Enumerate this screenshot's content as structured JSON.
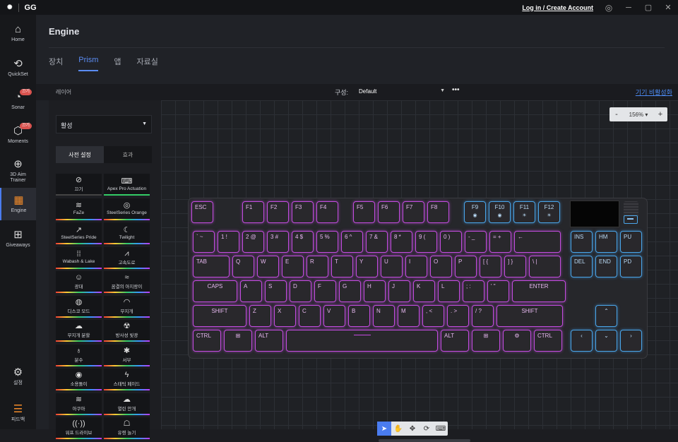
{
  "titlebar": {
    "brand": "GG",
    "login": "Log in / Create Account",
    "minimize": "─",
    "maximize": "▢",
    "close": "✕"
  },
  "sidebar": {
    "items": [
      {
        "label": "Home",
        "icon": "home-icon",
        "glyph": "⌂"
      },
      {
        "label": "QuickSet",
        "icon": "quickset-icon",
        "glyph": "⟲"
      },
      {
        "label": "Sonar",
        "icon": "sonar-icon",
        "glyph": "◔",
        "badge": "끄기"
      },
      {
        "label": "Moments",
        "icon": "moments-icon",
        "glyph": "⬡",
        "badge": "끄기"
      },
      {
        "label": "3D Aim Trainer",
        "icon": "aim-trainer-icon",
        "glyph": "⊕"
      },
      {
        "label": "Engine",
        "icon": "engine-icon",
        "glyph": "▦",
        "active": true
      },
      {
        "label": "Giveaways",
        "icon": "giveaways-icon",
        "glyph": "⊞"
      }
    ],
    "settings": {
      "label": "설정",
      "glyph": "⚙"
    },
    "feedback": {
      "label": "피드백",
      "glyph": "☰"
    }
  },
  "header": {
    "title": "Engine"
  },
  "tabs": [
    {
      "label": "장치"
    },
    {
      "label": "Prism",
      "active": true
    },
    {
      "label": "앱"
    },
    {
      "label": "자료실"
    }
  ],
  "toolbar": {
    "layer_label": "레이어",
    "config_label": "구성:",
    "config_value": "Default",
    "more": "•••",
    "disable_link": "기기 비활성화"
  },
  "layer_panel": {
    "dropdown_value": "활성",
    "segments": [
      "사전 설정",
      "효과"
    ],
    "presets": [
      {
        "label": "끄기",
        "glyph": "⊘"
      },
      {
        "label": "Apex Pro Actuation",
        "glyph": "⌨"
      },
      {
        "label": "FaZe",
        "glyph": "≋"
      },
      {
        "label": "SteelSeries Orange",
        "glyph": "◎"
      },
      {
        "label": "SteelSeries Pride",
        "glyph": "↗"
      },
      {
        "label": "Twilight",
        "glyph": "☾"
      },
      {
        "label": "Wabash & Lake",
        "glyph": "⁞⁞"
      },
      {
        "label": "고속도로",
        "glyph": "⩘"
      },
      {
        "label": "광대",
        "glyph": "☺"
      },
      {
        "label": "꿈결의 아지랑이",
        "glyph": "≈"
      },
      {
        "label": "디스코 모드",
        "glyph": "◍"
      },
      {
        "label": "무지개",
        "glyph": "◠"
      },
      {
        "label": "무지개 분할",
        "glyph": "☁"
      },
      {
        "label": "방사성 빛광",
        "glyph": "☢"
      },
      {
        "label": "분수",
        "glyph": "♁"
      },
      {
        "label": "서부",
        "glyph": "✱"
      },
      {
        "label": "소용돌이",
        "glyph": "◉"
      },
      {
        "label": "스태틱 페이드",
        "glyph": "ϟ"
      },
      {
        "label": "아쿠아",
        "glyph": "≋"
      },
      {
        "label": "열린 안개",
        "glyph": "☁"
      },
      {
        "label": "워프 드라이브",
        "glyph": "((·))"
      },
      {
        "label": "유령 놀기",
        "glyph": "☖"
      }
    ]
  },
  "canvas": {
    "zoom": "156%",
    "zoom_minus": "-",
    "zoom_plus": "+",
    "tools": [
      "select-tool",
      "hand-tool",
      "move-tool",
      "cycle-tool",
      "keyboard-tool"
    ]
  },
  "keyboard": {
    "rows": {
      "fn": [
        "ESC",
        "F1",
        "F2",
        "F3",
        "F4",
        "F5",
        "F6",
        "F7",
        "F8",
        "F9",
        "F10",
        "F11",
        "F12"
      ],
      "num": [
        "` ~",
        "1 !",
        "2 @",
        "3 #",
        "4 $",
        "5 %",
        "6 ^",
        "7 &",
        "8 *",
        "9 (",
        "0 )",
        "- _",
        "= +",
        "←",
        "INS",
        "HM",
        "PU"
      ],
      "tab": [
        "TAB",
        "Q",
        "W",
        "E",
        "R",
        "T",
        "Y",
        "U",
        "I",
        "O",
        "P",
        "[ {",
        "] }",
        "\\ |",
        "DEL",
        "END",
        "PD"
      ],
      "caps": [
        "CAPS",
        "A",
        "S",
        "D",
        "F",
        "G",
        "H",
        "J",
        "K",
        "L",
        "; :",
        "' \"",
        "ENTER"
      ],
      "shift": [
        "SHIFT",
        "Z",
        "X",
        "C",
        "V",
        "B",
        "N",
        "M",
        ", <",
        ". >",
        "/ ?",
        "SHIFT",
        "^"
      ],
      "bottom": [
        "CTRL",
        "⊞",
        "ALT",
        "",
        "ALT",
        "⊞",
        "⚙",
        "CTRL",
        "<",
        "v",
        ">"
      ]
    },
    "fn_icons": {
      "F9": "◉",
      "F10": "◉",
      "F11": "☀",
      "F12": "☀"
    }
  }
}
